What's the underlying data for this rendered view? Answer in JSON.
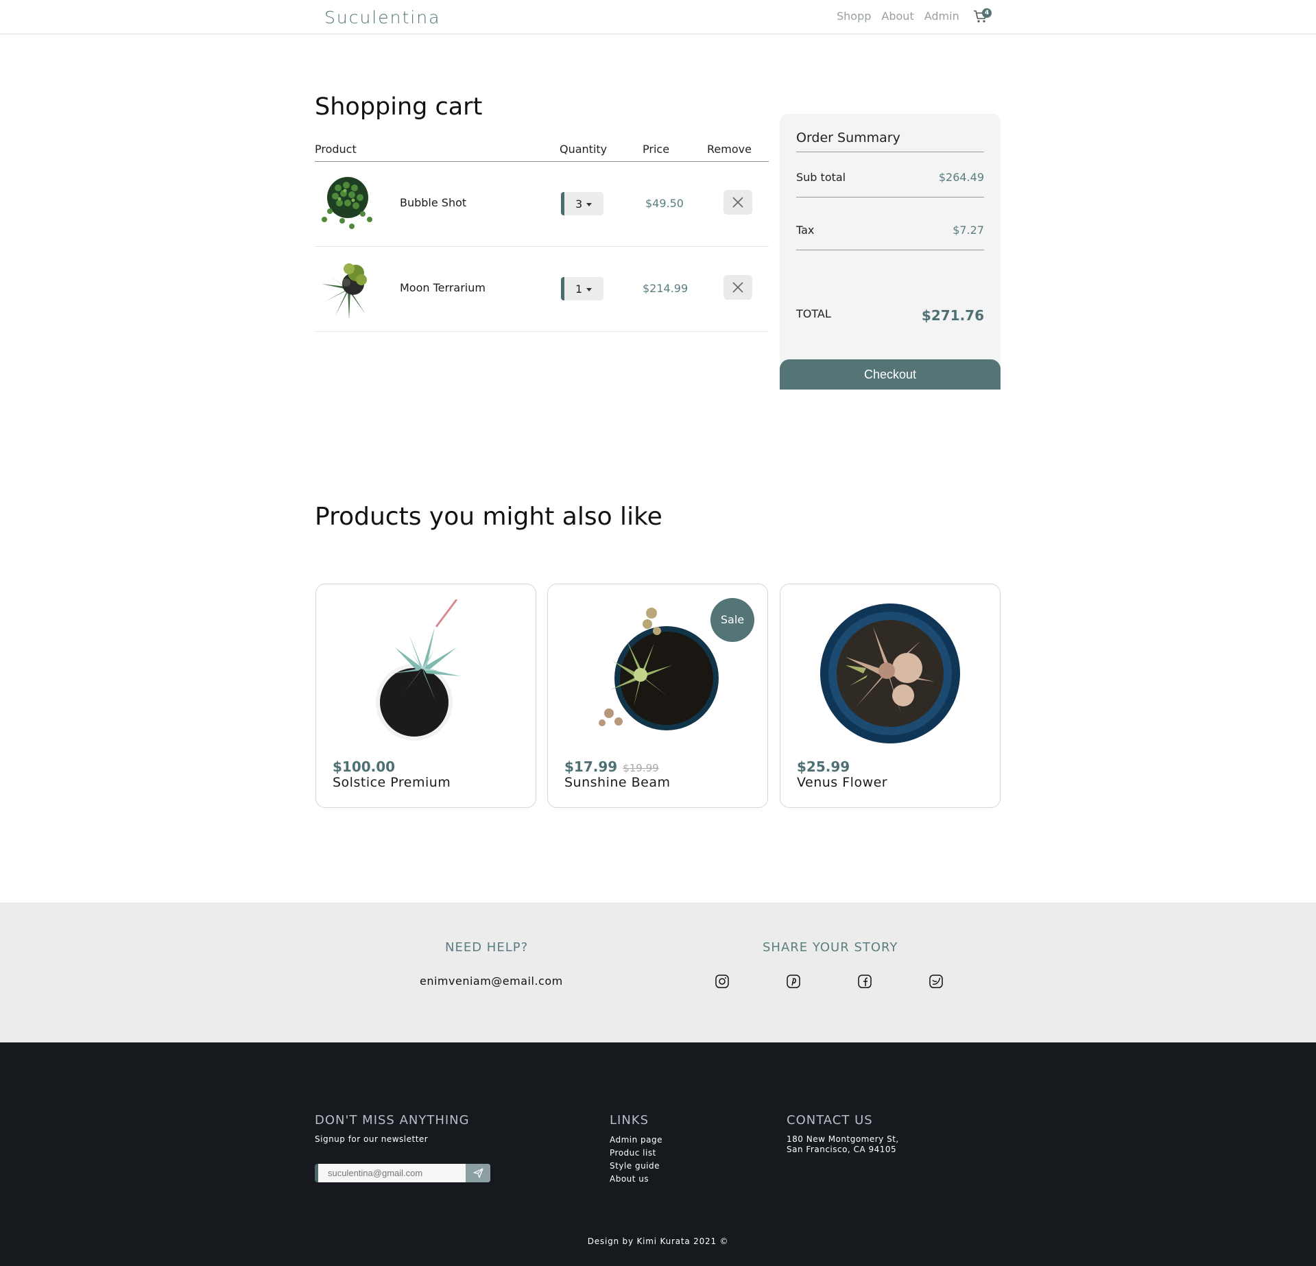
{
  "nav": {
    "logo": "Suculentina",
    "links": [
      "Shopp",
      "About",
      "Admin"
    ],
    "cart_icon": "cart-icon",
    "cart_count": "4"
  },
  "cart": {
    "title": "Shopping cart",
    "headers": {
      "product": "Product",
      "quantity": "Quantity",
      "price": "Price",
      "remove": "Remove"
    },
    "items": [
      {
        "name": "Bubble Shot",
        "quantity": "3",
        "price": "$49.50",
        "remove_icon": "close-icon"
      },
      {
        "name": "Moon Terrarium",
        "quantity": "1",
        "price": "$214.99",
        "remove_icon": "close-icon"
      }
    ]
  },
  "summary": {
    "title": "Order Summary",
    "subtotal_label": "Sub total",
    "subtotal_value": "$264.49",
    "tax_label": "Tax",
    "tax_value": "$7.27",
    "total_label": "TOTAL",
    "total_value": "$271.76",
    "checkout_label": "Checkout"
  },
  "recommended": {
    "title": "Products you might also like",
    "products": [
      {
        "price": "$100.00",
        "old_price": "",
        "name": "Solstice Premium",
        "badge": ""
      },
      {
        "price": "$17.99",
        "old_price": "$19.99",
        "name": "Sunshine Beam",
        "badge": "Sale"
      },
      {
        "price": "$25.99",
        "old_price": "",
        "name": "Venus Flower",
        "badge": ""
      }
    ]
  },
  "help": {
    "title": "NEED HELP?",
    "email": "enimveniam@email.com",
    "share_title": "SHARE YOUR STORY",
    "social_icons": [
      "instagram-icon",
      "pinterest-icon",
      "facebook-icon",
      "twitter-icon"
    ]
  },
  "footer": {
    "newsletter_title": "DON'T MISS ANYTHING",
    "newsletter_sub": "Signup for our newsletter",
    "newsletter_placeholder": "suculentina@gmail.com",
    "send_icon": "send-icon",
    "links_title": "LINKS",
    "links": [
      "Admin page",
      "Produc list",
      "Style guide",
      "About us"
    ],
    "contact_title": "CONTACT US",
    "address_line1": "180 New Montgomery St,",
    "address_line2": "San Francisco, CA 94105",
    "credit": "Design by Kimi Kurata 2021 ©"
  },
  "colors": {
    "accent": "#547476",
    "price": "#5a7d7f",
    "footer_bg": "#161a1f",
    "help_bg": "#ececec"
  }
}
